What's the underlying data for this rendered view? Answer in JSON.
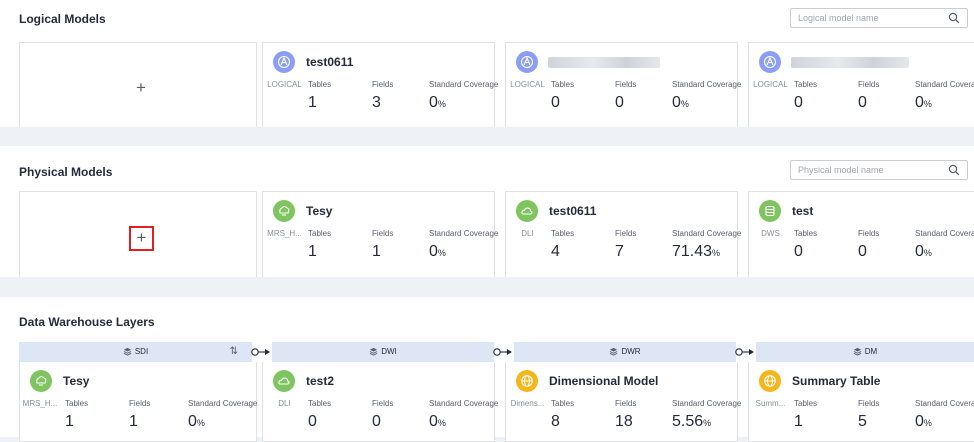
{
  "logical": {
    "title": "Logical Models",
    "search_placeholder": "Logical model name",
    "cards": [
      {
        "name": "test0611",
        "type": "LOGICAL",
        "tables": "1",
        "fields": "3",
        "coverage": "0",
        "unit": "%"
      },
      {
        "name": "",
        "type": "LOGICAL",
        "tables": "0",
        "fields": "0",
        "coverage": "0",
        "unit": "%"
      },
      {
        "name": "",
        "type": "LOGICAL",
        "tables": "0",
        "fields": "0",
        "coverage": "0",
        "unit": "%"
      }
    ]
  },
  "physical": {
    "title": "Physical Models",
    "search_placeholder": "Physical model name",
    "cards": [
      {
        "name": "Tesy",
        "type": "MRS_H...",
        "tables": "1",
        "fields": "1",
        "coverage": "0",
        "unit": "%"
      },
      {
        "name": "test0611",
        "type": "DLI",
        "tables": "4",
        "fields": "7",
        "coverage": "71.43",
        "unit": "%"
      },
      {
        "name": "test",
        "type": "DWS",
        "tables": "0",
        "fields": "0",
        "coverage": "0",
        "unit": "%"
      }
    ]
  },
  "dw": {
    "title": "Data Warehouse Layers",
    "layers": [
      {
        "name": "SDI",
        "sort_icon": "⇅"
      },
      {
        "name": "DWI"
      },
      {
        "name": "DWR"
      },
      {
        "name": "DM"
      }
    ],
    "cards": [
      {
        "name": "Tesy",
        "type": "MRS_H...",
        "tables": "1",
        "fields": "1",
        "coverage": "0",
        "unit": "%"
      },
      {
        "name": "test2",
        "type": "DLI",
        "tables": "0",
        "fields": "0",
        "coverage": "0",
        "unit": "%"
      },
      {
        "name": "Dimensional Model",
        "type": "Dimens...",
        "tables": "8",
        "fields": "18",
        "coverage": "5.56",
        "unit": "%"
      },
      {
        "name": "Summary Table",
        "type": "Summ...",
        "tables": "1",
        "fields": "5",
        "coverage": "0",
        "unit": "%"
      }
    ]
  },
  "labels": {
    "plus": "+",
    "tables": "Tables",
    "fields": "Fields",
    "coverage": "Standard Coverage"
  },
  "colors": {
    "logical_icon": "#8b9ef5",
    "mrs_icon": "#7ec55f",
    "dli_icon": "#7ec55f",
    "dws_icon": "#7ec55f",
    "dm_icon": "#f5b51b",
    "highlight": "#e02020",
    "layer_header": "#dce6f5"
  }
}
